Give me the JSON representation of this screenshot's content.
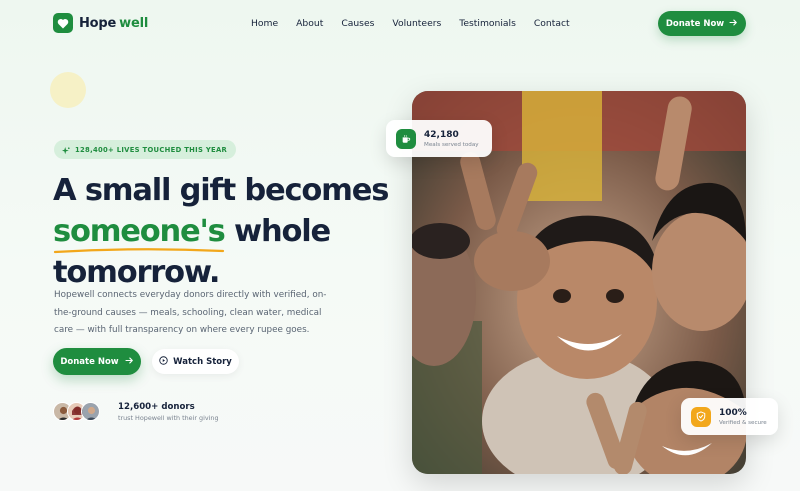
{
  "brand": {
    "name_part1": "Hope",
    "name_part2": "well"
  },
  "nav": {
    "items": [
      "Home",
      "About",
      "Causes",
      "Volunteers",
      "Testimonials",
      "Contact"
    ]
  },
  "header_cta": {
    "label": "Donate Now",
    "icon": "arrow-right-icon"
  },
  "hero": {
    "badge": "128,400+ LIVES TOUCHED THIS YEAR",
    "headline_line1": "A small gift becomes",
    "headline_highlight": "someone's",
    "headline_line2_rest": " whole",
    "headline_line3": "tomorrow.",
    "description": "Hopewell connects everyday donors directly with verified, on-the-ground causes — meals, schooling, clean water, medical care — with full transparency on where every rupee goes.",
    "primary_cta": "Donate Now",
    "secondary_cta": "Watch Story",
    "donors_title": "12,600+ donors",
    "donors_subtitle": "trust Hopewell with their giving"
  },
  "stats": {
    "meals": {
      "value": "42,180",
      "label": "Meals served today",
      "icon": "cup-icon"
    },
    "verified": {
      "value": "100%",
      "label": "Verified & secure",
      "icon": "shield-icon"
    }
  },
  "colors": {
    "primary": "#1f8d3f",
    "dark": "#16223a",
    "accent_yellow": "#f2a71b",
    "badge_bg": "#d6efdc"
  }
}
